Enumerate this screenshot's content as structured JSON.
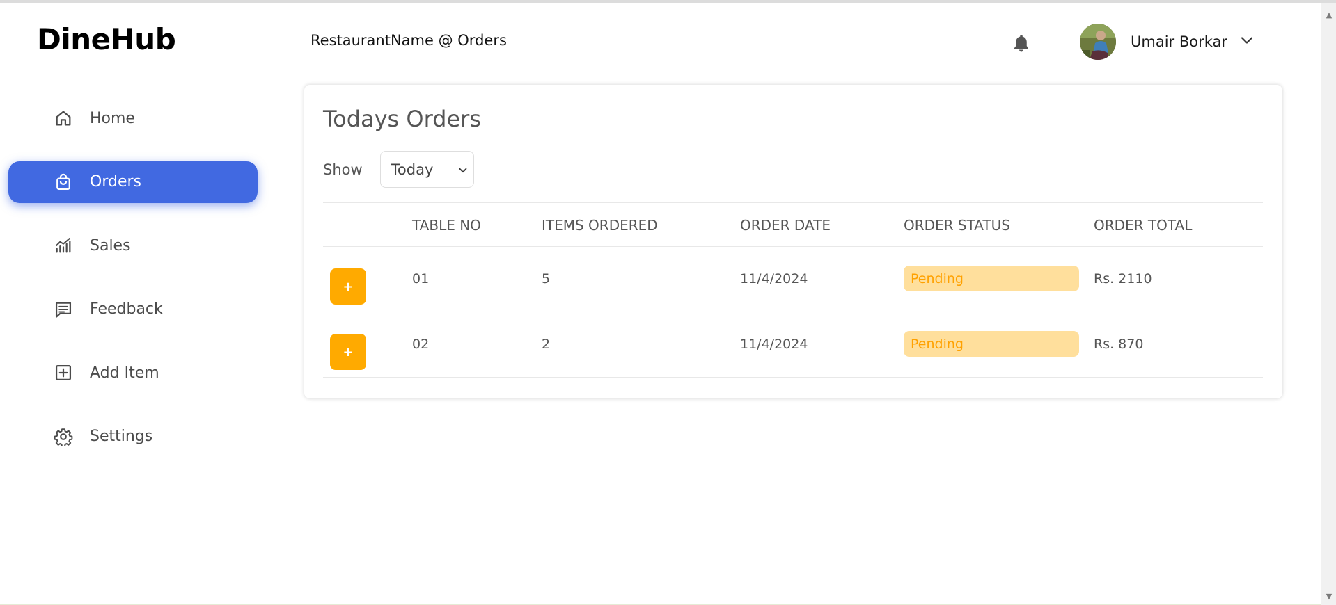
{
  "app": {
    "name": "DineHub"
  },
  "header": {
    "title": "RestaurantName @ Orders",
    "user_name": "Umair Borkar",
    "notification_icon": "bell-icon",
    "dropdown_icon": "chevron-down-icon"
  },
  "sidebar": {
    "items": [
      {
        "label": "Home",
        "icon": "home-icon",
        "active": false
      },
      {
        "label": "Orders",
        "icon": "shopping-bag-icon",
        "active": true
      },
      {
        "label": "Sales",
        "icon": "chart-icon",
        "active": false
      },
      {
        "label": "Feedback",
        "icon": "message-icon",
        "active": false
      },
      {
        "label": "Add Item",
        "icon": "plus-square-icon",
        "active": false
      },
      {
        "label": "Settings",
        "icon": "gear-icon",
        "active": false
      }
    ]
  },
  "main": {
    "title": "Todays Orders",
    "show_label": "Show",
    "show_value": "Today",
    "columns": [
      "TABLE NO",
      "ITEMS ORDERED",
      "ORDER DATE",
      "ORDER STATUS",
      "ORDER TOTAL"
    ],
    "rows": [
      {
        "expand_label": "+",
        "table_no": "01",
        "items": "5",
        "date": "11/4/2024",
        "status": "Pending",
        "total": "Rs. 2110"
      },
      {
        "expand_label": "+",
        "table_no": "02",
        "items": "2",
        "date": "11/4/2024",
        "status": "Pending",
        "total": "Rs. 870"
      }
    ]
  },
  "colors": {
    "accent": "#4169e1",
    "action": "#ffaa00",
    "pending_bg": "#ffdf9c",
    "pending_text": "#ffa100"
  }
}
